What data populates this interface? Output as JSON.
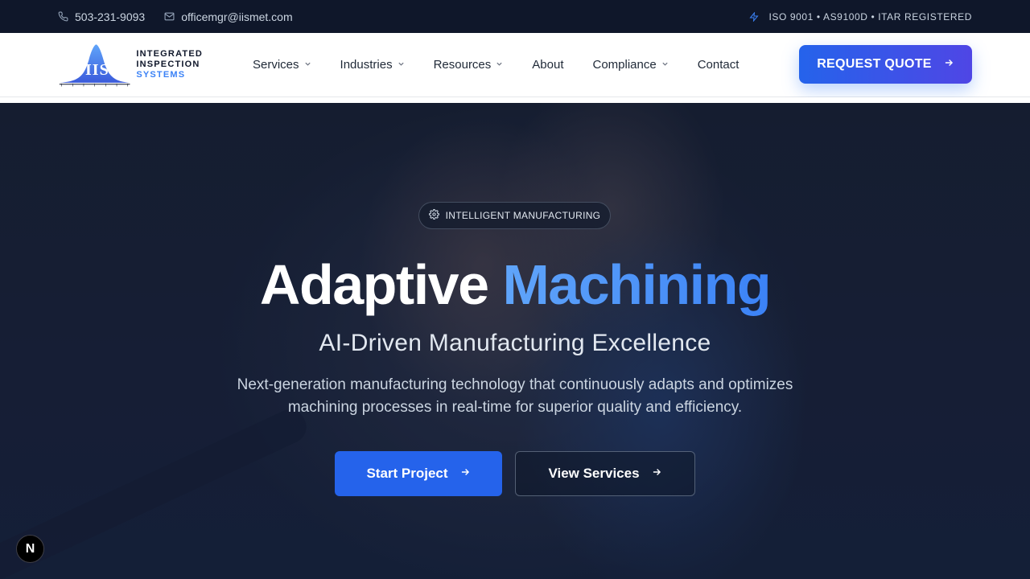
{
  "topbar": {
    "phone": "503-231-9093",
    "phone_icon": "phone-icon",
    "email": "officemgr@iismet.com",
    "email_icon": "mail-icon",
    "certs": "ISO 9001 • AS9100D • ITAR REGISTERED",
    "certs_icon": "bolt-icon"
  },
  "logo": {
    "monogram": "IIS",
    "line1": "INTEGRATED",
    "line2": "INSPECTION",
    "line3": "SYSTEMS"
  },
  "nav": {
    "items": [
      {
        "label": "Services",
        "dropdown": true
      },
      {
        "label": "Industries",
        "dropdown": true
      },
      {
        "label": "Resources",
        "dropdown": true
      },
      {
        "label": "About",
        "dropdown": false
      },
      {
        "label": "Compliance",
        "dropdown": true
      },
      {
        "label": "Contact",
        "dropdown": false
      }
    ],
    "cta": "REQUEST QUOTE"
  },
  "hero": {
    "badge": "INTELLIGENT MANUFACTURING",
    "badge_icon": "gear-icon",
    "headline_part1": "Adaptive",
    "headline_part2": "Machining",
    "subheadline": "AI-Driven Manufacturing Excellence",
    "description": "Next-generation manufacturing technology that continuously adapts and optimizes machining processes in real-time for superior quality and efficiency.",
    "primary_button": "Start Project",
    "secondary_button": "View Services"
  },
  "floating_badge": "N",
  "colors": {
    "accent": "#2563eb",
    "accent_light": "#60a5fa",
    "topbar_bg": "#0f172a",
    "nav_bg": "#ffffff"
  }
}
